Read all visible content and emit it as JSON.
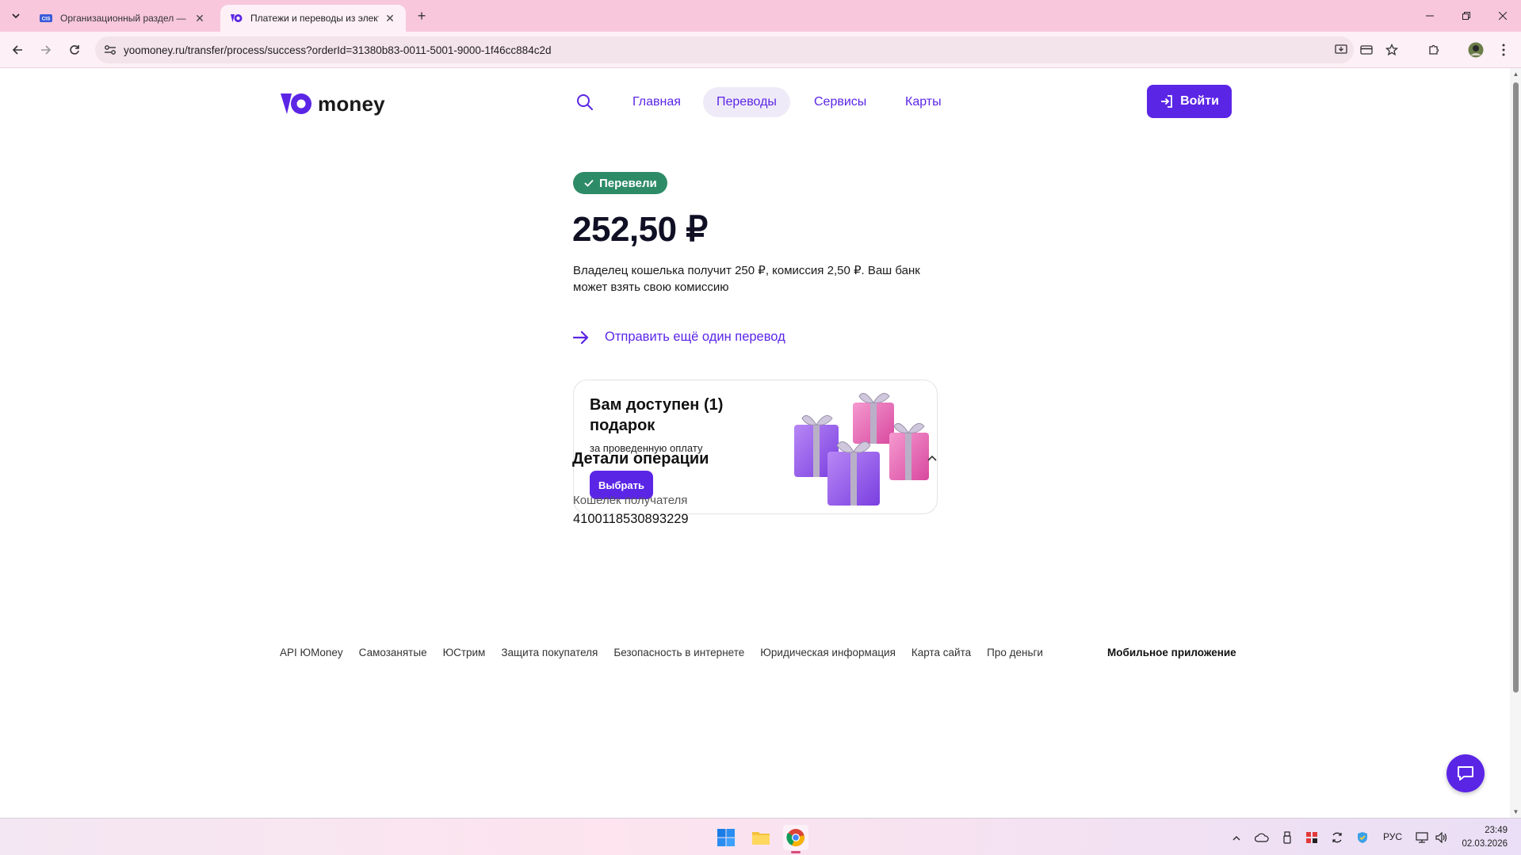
{
  "browser": {
    "tabs": [
      {
        "title": "Организационный раздел — ",
        "icon": "cis-favicon"
      },
      {
        "title": "Платежи и переводы из элект",
        "icon": "yoomoney-favicon"
      }
    ],
    "url": "yoomoney.ru/transfer/process/success?orderId=31380b83-0011-5001-9000-1f46cc884c2d"
  },
  "header": {
    "logo_text": "money",
    "nav": [
      "Главная",
      "Переводы",
      "Сервисы",
      "Карты"
    ],
    "login_label": "Войти"
  },
  "result": {
    "status": "Перевели",
    "amount": "252,50 ₽",
    "description": "Владелец кошелька получит 250 ₽, комиссия 2,50 ₽. Ваш банк может взять свою комиссию",
    "again_link": "Отправить ещё один перевод"
  },
  "gift": {
    "title": "Вам доступен (1) подарок",
    "subtitle": "за проведенную оплату",
    "button": "Выбрать"
  },
  "details": {
    "heading": "Детали операции",
    "fields": [
      {
        "label": "Кошелёк получателя",
        "value": "4100118530893229"
      }
    ]
  },
  "footer": {
    "links": [
      "API ЮMoney",
      "Самозанятые",
      "ЮСтрим",
      "Защита покупателя",
      "Безопасность в интернете",
      "Юридическая информация",
      "Карта сайта",
      "Про деньги"
    ],
    "app": "Мобильное приложение"
  },
  "taskbar": {
    "lang": "РУС",
    "time": "23:49",
    "date": "02.03.2026"
  },
  "colors": {
    "brand": "#5b25e6",
    "success": "#2e8b68",
    "tabstrip": "#f8c7dc"
  }
}
